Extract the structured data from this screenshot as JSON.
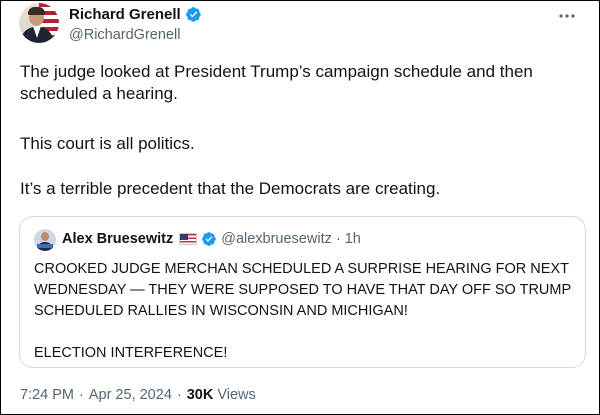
{
  "author": {
    "display_name": "Richard Grenell",
    "handle": "@RichardGrenell",
    "verified": true
  },
  "tweet": {
    "paragraphs": [
      "The judge looked at President Trump’s campaign schedule and then scheduled a hearing.",
      "This court is all politics.",
      "It’s a terrible precedent that the Democrats are creating."
    ]
  },
  "quote": {
    "display_name": "Alex Bruesewitz",
    "flag_emoji": "us-flag",
    "verified": true,
    "handle": "@alexbruesewitz",
    "separator": "·",
    "time_ago": "1h",
    "text_main": "CROOKED JUDGE MERCHAN SCHEDULED A SURPRISE HEARING FOR NEXT WEDNESDAY — THEY WERE SUPPOSED TO HAVE THAT DAY OFF SO TRUMP SCHEDULED RALLIES IN WISCONSIN AND MICHIGAN!",
    "text_end": "ELECTION INTERFERENCE!"
  },
  "meta": {
    "time": "7:24 PM",
    "dot1": "·",
    "date": "Apr 25, 2024",
    "dot2": "·",
    "views_count": "30K",
    "views_label": "Views"
  },
  "colors": {
    "verified_blue": "#1d9bf0",
    "text_primary": "#0f1419",
    "text_secondary": "#536471",
    "border": "#cfd9de"
  },
  "icons": {
    "more": "more-horizontal-icon",
    "verified": "verified-badge-icon"
  }
}
